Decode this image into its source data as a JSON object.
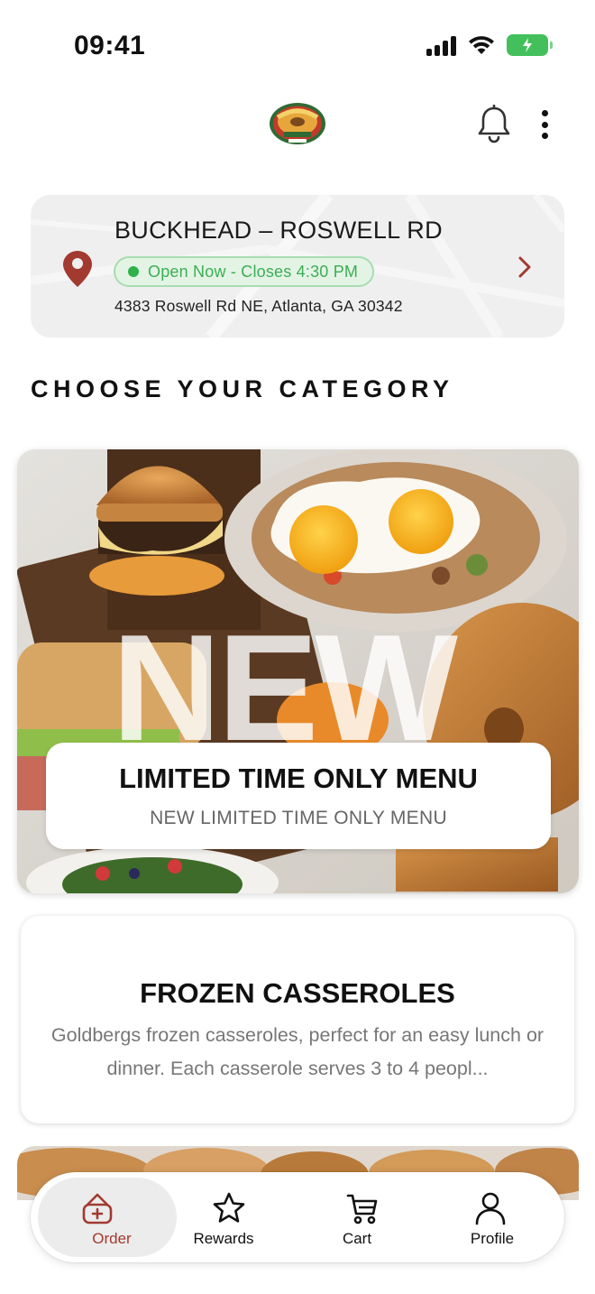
{
  "status_bar": {
    "time": "09:41"
  },
  "header": {
    "logo_alt": "Goldbergs Fine Foods logo"
  },
  "location": {
    "name": "BUCKHEAD – ROSWELL RD",
    "status": "Open Now - Closes 4:30 PM",
    "address": "4383 Roswell Rd NE, Atlanta, GA 30342"
  },
  "section_title": "CHOOSE YOUR CATEGORY",
  "categories": [
    {
      "title": "LIMITED TIME ONLY MENU",
      "subtitle": "NEW LIMITED TIME ONLY MENU",
      "image_text": "NEW"
    },
    {
      "title": "FROZEN CASSEROLES",
      "description": "Goldbergs frozen casseroles, perfect for an easy lunch or dinner. Each casserole serves 3 to 4 peopl..."
    }
  ],
  "bottom_nav": [
    {
      "label": "Order",
      "icon": "order-icon",
      "active": true
    },
    {
      "label": "Rewards",
      "icon": "star-icon",
      "active": false
    },
    {
      "label": "Cart",
      "icon": "cart-icon",
      "active": false
    },
    {
      "label": "Profile",
      "icon": "profile-icon",
      "active": false
    }
  ],
  "colors": {
    "accent": "#a23a30",
    "open_green": "#3cae54",
    "battery": "#43c05b",
    "card_bg": "#efefef"
  }
}
